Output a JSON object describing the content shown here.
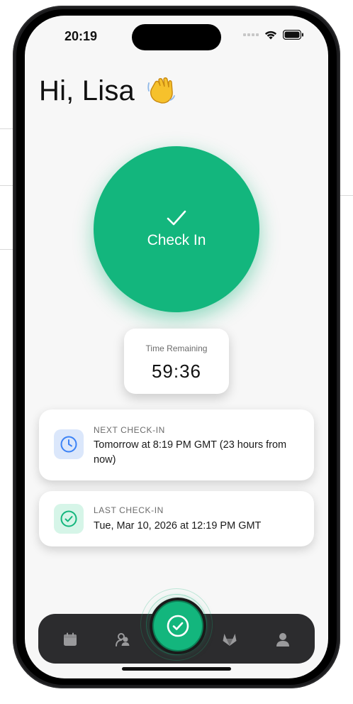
{
  "status_bar": {
    "time": "20:19"
  },
  "greeting": {
    "text": "Hi, Lisa",
    "emoji": "waving-hand"
  },
  "checkin_button": {
    "label": "Check In",
    "color": "#13b67d"
  },
  "timer": {
    "label": "Time Remaining",
    "value": "59:36"
  },
  "next_checkin": {
    "title": "NEXT CHECK-IN",
    "text": "Tomorrow at 8:19 PM GMT (23 hours from now)",
    "icon": "clock-icon",
    "accent": "#3b82f6"
  },
  "last_checkin": {
    "title": "LAST CHECK-IN",
    "text": "Tue, Mar 10, 2026 at 12:19 PM GMT",
    "icon": "check-circle-icon",
    "accent": "#13b67d"
  },
  "bottom_nav": {
    "items": [
      {
        "icon": "calendar-icon"
      },
      {
        "icon": "contacts-icon"
      },
      {
        "icon": "check-circle-icon",
        "active": true
      },
      {
        "icon": "gitlab-icon"
      },
      {
        "icon": "profile-icon"
      }
    ]
  }
}
